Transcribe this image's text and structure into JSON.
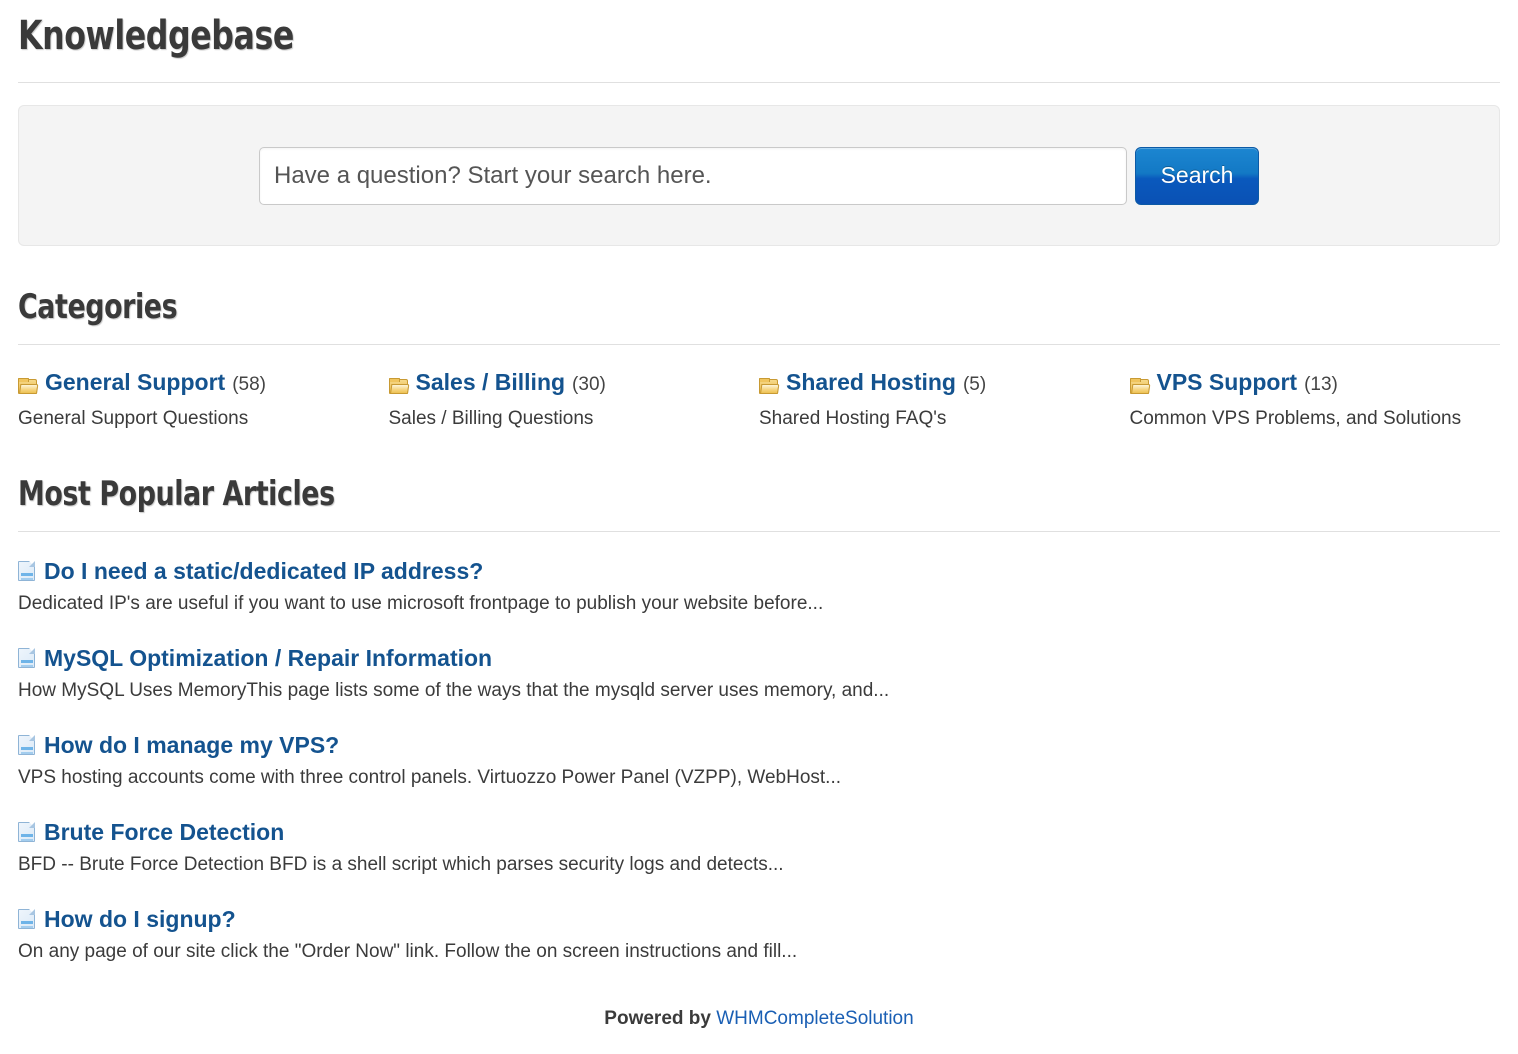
{
  "page": {
    "title": "Knowledgebase"
  },
  "search": {
    "placeholder": "Have a question? Start your search here.",
    "value": "",
    "button_label": "Search"
  },
  "categories_section": {
    "title": "Categories",
    "items": [
      {
        "name": "General Support",
        "count": "(58)",
        "description": "General Support Questions",
        "icon": "folder-icon"
      },
      {
        "name": "Sales / Billing",
        "count": "(30)",
        "description": "Sales / Billing Questions",
        "icon": "folder-icon"
      },
      {
        "name": "Shared Hosting",
        "count": "(5)",
        "description": "Shared Hosting FAQ's",
        "icon": "folder-icon"
      },
      {
        "name": "VPS Support",
        "count": "(13)",
        "description": "Common VPS Problems, and Solutions",
        "icon": "folder-icon"
      }
    ]
  },
  "articles_section": {
    "title": "Most Popular Articles",
    "items": [
      {
        "title": "Do I need a static/dedicated IP address?",
        "excerpt": "Dedicated IP's are useful if you want to use microsoft frontpage to publish your website before...",
        "icon": "document-icon"
      },
      {
        "title": "MySQL Optimization / Repair Information",
        "excerpt": "How MySQL Uses MemoryThis page lists some of the ways that the mysqld server uses memory, and...",
        "icon": "document-icon"
      },
      {
        "title": "How do I manage my VPS?",
        "excerpt": "VPS hosting accounts come with three control panels. Virtuozzo Power Panel (VZPP), WebHost...",
        "icon": "document-icon"
      },
      {
        "title": "Brute Force Detection",
        "excerpt": "BFD -- Brute Force Detection BFD is a shell script which parses security logs and detects...",
        "icon": "document-icon"
      },
      {
        "title": "How do I signup?",
        "excerpt": "On any page of our site click the \"Order Now\" link. Follow the on screen instructions and fill...",
        "icon": "document-icon"
      }
    ]
  },
  "footer": {
    "powered_by": "Powered by",
    "brand": "WHMCompleteSolution"
  },
  "colors": {
    "link_blue": "#14538f",
    "footer_link_blue": "#1a5fb4",
    "heading_gray": "#3a3a3a",
    "panel_bg": "#f4f4f4",
    "button_blue_top": "#1c86d1",
    "button_blue_bottom": "#0a51b4",
    "rule_gray": "#e0e0e0"
  }
}
